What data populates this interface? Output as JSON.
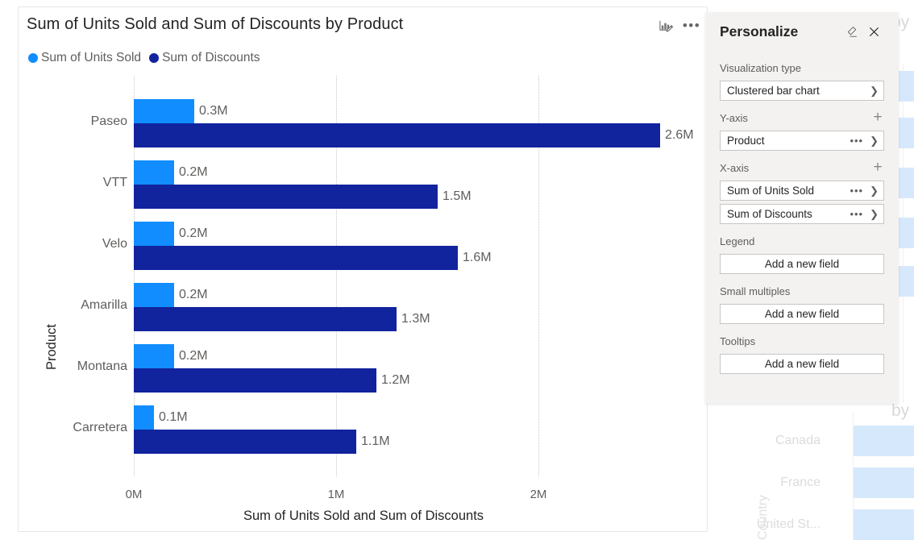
{
  "visual": {
    "title": "Sum of Units Sold and Sum of Discounts by Product",
    "personalize_icon": "personalize-visual-icon",
    "more_options_icon": "more-options-icon",
    "legend": [
      {
        "label": "Sum of Units Sold",
        "color": "#118DFF"
      },
      {
        "label": "Sum of Discounts",
        "color": "#12239E"
      }
    ],
    "y_axis_title": "Product",
    "x_axis_title": "Sum of Units Sold and Sum of Discounts"
  },
  "chart_data": {
    "type": "bar",
    "title": "Sum of Units Sold and Sum of Discounts by Product",
    "xlabel": "Sum of Units Sold and Sum of Discounts",
    "ylabel": "Product",
    "orientation": "horizontal",
    "grid": true,
    "legend_position": "top-left",
    "xlim": [
      0,
      2.9
    ],
    "xticks": [
      "0M",
      "1M",
      "2M"
    ],
    "xtick_values": [
      0,
      1000000,
      2000000
    ],
    "categories": [
      "Paseo",
      "VTT",
      "Velo",
      "Amarilla",
      "Montana",
      "Carretera"
    ],
    "series": [
      {
        "name": "Sum of Units Sold",
        "color": "#118DFF",
        "values": [
          0.3,
          0.2,
          0.2,
          0.2,
          0.2,
          0.1
        ],
        "labels": [
          "0.3M",
          "0.2M",
          "0.2M",
          "0.2M",
          "0.2M",
          "0.1M"
        ]
      },
      {
        "name": "Sum of Discounts",
        "color": "#12239E",
        "values": [
          2.6,
          1.5,
          1.6,
          1.3,
          1.2,
          1.1
        ],
        "labels": [
          "2.6M",
          "1.5M",
          "1.6M",
          "1.3M",
          "1.2M",
          "1.1M"
        ]
      }
    ]
  },
  "personalize": {
    "title": "Personalize",
    "reset_icon": "eraser-icon",
    "close_icon": "close-icon",
    "sections": [
      {
        "label": "Visualization type",
        "has_add": false,
        "fields": [
          {
            "text": "Clustered bar chart",
            "dots": false,
            "chevron": true
          }
        ]
      },
      {
        "label": "Y-axis",
        "has_add": true,
        "fields": [
          {
            "text": "Product",
            "dots": true,
            "chevron": true
          }
        ]
      },
      {
        "label": "X-axis",
        "has_add": true,
        "fields": [
          {
            "text": "Sum of Units Sold",
            "dots": true,
            "chevron": true
          },
          {
            "text": "Sum of Discounts",
            "dots": true,
            "chevron": true
          }
        ]
      },
      {
        "label": "Legend",
        "has_add": false,
        "add_field_label": "Add a new field"
      },
      {
        "label": "Small multiples",
        "has_add": false,
        "add_field_label": "Add a new field"
      },
      {
        "label": "Tooltips",
        "has_add": false,
        "add_field_label": "Add a new field"
      }
    ]
  },
  "background": {
    "titles": [
      "by",
      "by"
    ],
    "categories": [
      "Canada",
      "France",
      "United St..."
    ],
    "axis_title": "Country"
  },
  "colors": {
    "units_sold": "#118DFF",
    "discounts": "#12239E",
    "pane_bg": "#F3F2F1",
    "text": "#252423",
    "muted_text": "#605E5C"
  }
}
